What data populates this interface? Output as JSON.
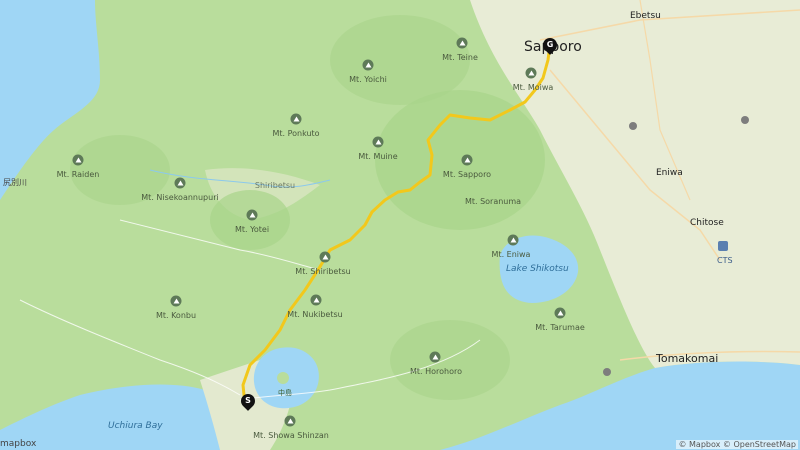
{
  "map": {
    "cities": {
      "sapporo": "Sapporo",
      "ebetsu": "Ebetsu",
      "eniwa": "Eniwa",
      "chitose": "Chitose",
      "tomakomai": "Tomakomai",
      "shiribetsu_town": "Shiribetsu"
    },
    "mountains": {
      "teine": "Mt. Teine",
      "yoichi": "Mt. Yoichi",
      "moiwa": "Mt. Moiwa",
      "ponkuto": "Mt. Ponkuto",
      "muine": "Mt. Muine",
      "sapporo": "Mt. Sapporo",
      "soranuma": "Mt. Soranuma",
      "raiden": "Mt. Raiden",
      "nisekoannupuri": "Mt. Nisekoannupuri",
      "yotei": "Mt. Yotei",
      "eniwa": "Mt. Eniwa",
      "shiribetsu": "Mt. Shiribetsu",
      "nukibetsu": "Mt. Nukibetsu",
      "konbu": "Mt. Konbu",
      "tarumae": "Mt. Tarumae",
      "horohoro": "Mt. Horohoro",
      "showa_shinzan": "Mt. Showa Shinzan"
    },
    "water": {
      "lake_shikotsu": "Lake Shikotsu",
      "uchiura_bay": "Uchiura Bay",
      "nakajima": "中島"
    },
    "airport_code": "CTS",
    "start_marker": "S",
    "goal_marker": "G",
    "attribution": "© Mapbox © OpenStreetMap",
    "logo": "mapbox",
    "partial_label_left": "尻別川",
    "colors": {
      "sea": "#9fd6f5",
      "forest": "#b9dd9c",
      "lowland": "#e8ecd6",
      "route": "#f2c81c"
    }
  }
}
